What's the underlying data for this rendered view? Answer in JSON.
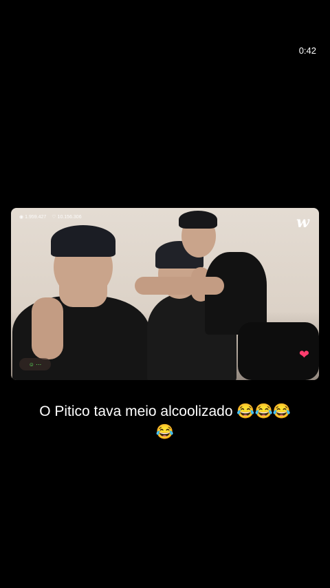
{
  "status": {
    "time": "0:42"
  },
  "video": {
    "views": "1.959.427",
    "likes": "10.156.306",
    "logo": "w",
    "heart_icon": "heart-icon",
    "comment_icon": "comment-icon"
  },
  "caption": {
    "line1": "O Pitico tava meio alcoolizado 😂😂😂",
    "line2": "😂"
  }
}
